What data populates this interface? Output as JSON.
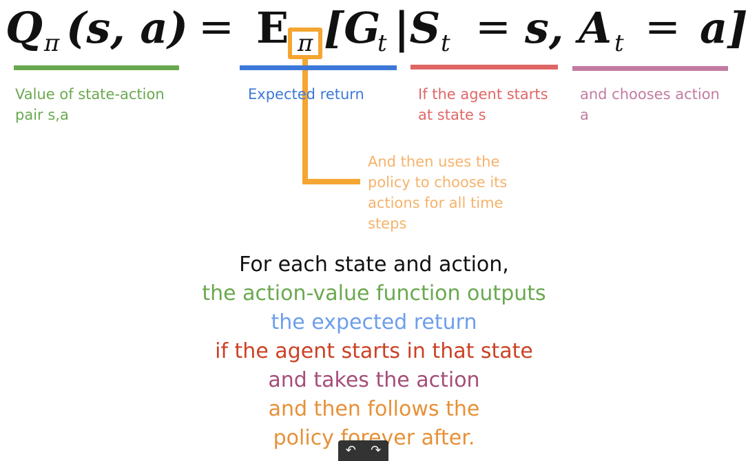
{
  "formula": {
    "q": "Q",
    "pi_sub": "π",
    "open_args": "(s, a)",
    "equals": "=",
    "expectation": "E",
    "expectation_sub": "π",
    "bracket_open": "[G",
    "t_sub_1": "t",
    "given": "|S",
    "t_sub_2": "t",
    "equals_2": "=",
    "s_comma": "s,",
    "a_t": "A",
    "t_sub_3": "t",
    "equals_3": "=",
    "a_close": "a]"
  },
  "annotations": {
    "value_label": [
      "Value of state-action",
      "pair s,a"
    ],
    "expected_label": [
      "Expected return"
    ],
    "starts_label": [
      "If the agent starts",
      "at state s"
    ],
    "chooses_label": [
      "and chooses action",
      "a"
    ],
    "policy_label": [
      "And then uses the",
      "policy to choose its",
      "actions for all time",
      "steps"
    ]
  },
  "summary": [
    "For each state and action,",
    "the action-value function outputs",
    "the expected return",
    "if the agent starts in that state",
    "and takes the action",
    "and then follows the",
    "policy forever after."
  ],
  "nav": {
    "prev_icon": "undo-arrow-icon",
    "next_icon": "redo-arrow-icon",
    "prev_glyph": "↶",
    "next_glyph": "↷"
  },
  "colors": {
    "green": "#6aa84f",
    "blue": "#3c78d8",
    "red": "#e06666",
    "pink": "#c27ba0",
    "orange": "#f6b26b",
    "summary_black": "#111111",
    "summary_green": "#6aa84f",
    "summary_blue": "#6d9eeb",
    "summary_red": "#cc4125",
    "summary_purple": "#a64d79",
    "summary_orange": "#e69138"
  }
}
